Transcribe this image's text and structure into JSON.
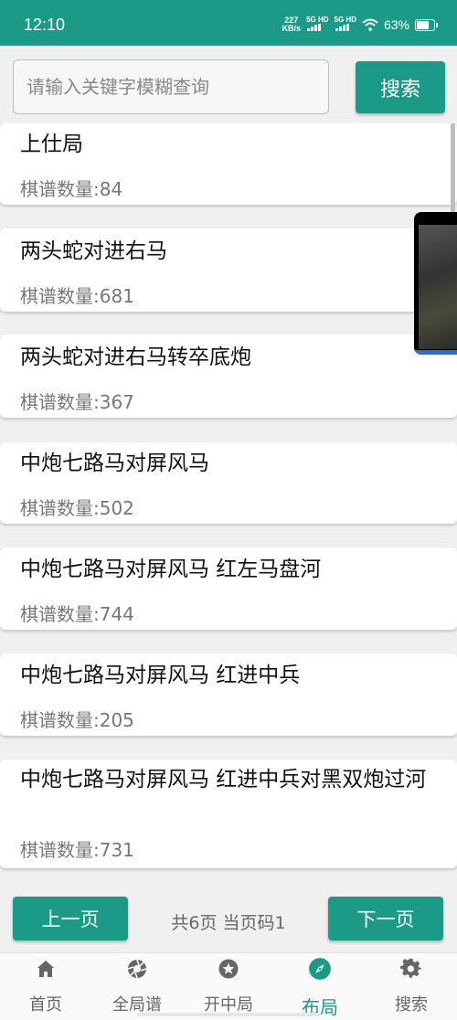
{
  "status_bar": {
    "time": "12:10",
    "net_speed_value": "227",
    "net_speed_unit": "KB/s",
    "sim1": "5G HD",
    "sim2": "5G HD",
    "battery_percent": "63%",
    "battery_level": 0.63
  },
  "search": {
    "placeholder": "请输入关键字模糊查询",
    "button_label": "搜索"
  },
  "list": {
    "items": [
      {
        "title": "上仕局",
        "count": "棋谱数量:84"
      },
      {
        "title": "两头蛇对进右马",
        "count": "棋谱数量:681"
      },
      {
        "title": "两头蛇对进右马转卒底炮",
        "count": "棋谱数量:367"
      },
      {
        "title": "中炮七路马对屏风马",
        "count": "棋谱数量:502"
      },
      {
        "title": "中炮七路马对屏风马 红左马盘河",
        "count": "棋谱数量:744"
      },
      {
        "title": "中炮七路马对屏风马 红进中兵",
        "count": "棋谱数量:205"
      },
      {
        "title": "中炮七路马对屏风马 红进中兵对黑双炮过河",
        "count": "棋谱数量:731"
      }
    ]
  },
  "pager": {
    "prev_label": "上一页",
    "next_label": "下一页",
    "info": "共6页  当页码1"
  },
  "tabbar": {
    "tabs": [
      {
        "label": "首页",
        "icon": "home-icon"
      },
      {
        "label": "全局谱",
        "icon": "aperture-icon"
      },
      {
        "label": "开中局",
        "icon": "star-icon"
      },
      {
        "label": "布局",
        "icon": "compass-icon",
        "active": true
      },
      {
        "label": "搜索",
        "icon": "gear-icon"
      }
    ]
  },
  "colors": {
    "accent": "#1c9a88",
    "inactive": "#666666"
  }
}
